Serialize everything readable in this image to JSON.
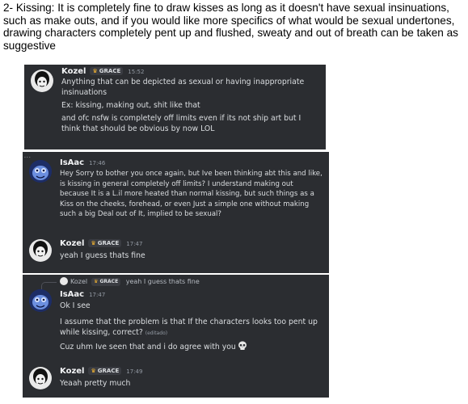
{
  "intro_text": "2- Kissing: It is completely fine to draw kisses as long as it doesn't have sexual insinuations, such as make outs, and if you would like more specifics of what would be sexual undertones, drawing characters completely pent up and flushed, sweaty and out of breath can be taken as suggestive",
  "role_tag": "GRACE",
  "panel1": {
    "author": "Kozel",
    "time": "15:52",
    "lines": [
      "Anything that can be depicted as sexual or having inappropriate insinuations",
      "Ex: kissing, making out, shit like that",
      "and ofc nsfw is completely off limits even if its not ship art but I think that should be obvious by now LOL"
    ]
  },
  "panel2": {
    "corner": "...",
    "msg1": {
      "author": "IsAac",
      "time": "17:46",
      "text": "Hey Sorry to bother you once again, but Ive been thinking abt this and like, is kissing in general completely off limits? I understand making out because It is a L.il more heated than normal kissing, but such things as a Kiss on the cheeks, forehead, or even Just a simple one without making such a big Deal out of It, implied to be sexual?"
    },
    "msg2": {
      "author": "Kozel",
      "time": "17:47",
      "text": "yeah I guess thats fine"
    }
  },
  "panel3": {
    "reply": {
      "author": "Kozel",
      "text": "yeah I guess thats fine"
    },
    "msg1": {
      "author": "IsAac",
      "time": "17:47",
      "lines": [
        "Ok I see",
        "I assume that the problem is that If the characters looks too pent up while kissing, correct?",
        "Cuz uhm Ive seen that and i do agree with you"
      ],
      "edited": "(editado)"
    },
    "msg2": {
      "author": "Kozel",
      "time": "17:49",
      "text": "Yeaah pretty much"
    }
  },
  "colors": {
    "panel_bg": "#2b2d31",
    "text": "#dbdee1",
    "timestamp": "#949ba4",
    "crown": "#f0b232"
  },
  "icons": [
    "kozel-avatar-icon",
    "isaac-avatar-icon",
    "crown-icon",
    "skull-emoji-icon",
    "reply-arrow-icon"
  ]
}
